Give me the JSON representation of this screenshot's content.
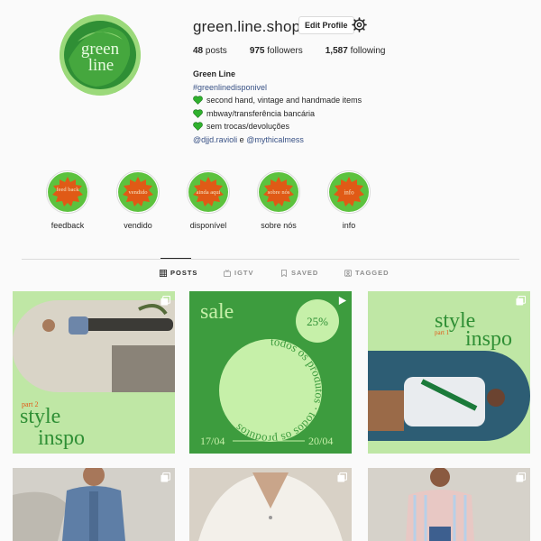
{
  "profile": {
    "username": "green.line.shop",
    "edit_label": "Edit Profile",
    "logo_text_top": "green",
    "logo_text_bottom": "line",
    "stats": {
      "posts": "48",
      "posts_label": "posts",
      "followers": "975",
      "followers_label": "followers",
      "following": "1,587",
      "following_label": "following"
    },
    "bio": {
      "name": "Green Line",
      "hashtag": "#greenlinedisponivel",
      "lines": [
        "second hand, vintage and handmade items",
        "mbway/transferência bancária",
        "sem trocas/devoluções"
      ],
      "mention1": "@djjd.ravioli",
      "connector": "e",
      "mention2": "@mythicalmess"
    }
  },
  "highlights": [
    {
      "label": "feedback",
      "badge": "feed back"
    },
    {
      "label": "vendido",
      "badge": "vendido"
    },
    {
      "label": "disponível",
      "badge": "ainda aqui"
    },
    {
      "label": "sobre nós",
      "badge": "sobre nós"
    },
    {
      "label": "info",
      "badge": "info"
    }
  ],
  "tabs": [
    {
      "label": "POSTS",
      "active": true,
      "icon": "grid-icon"
    },
    {
      "label": "IGTV",
      "active": false,
      "icon": "igtv-icon"
    },
    {
      "label": "SAVED",
      "active": false,
      "icon": "bookmark-icon"
    },
    {
      "label": "TAGGED",
      "active": false,
      "icon": "tag-icon"
    }
  ],
  "posts": {
    "p1": {
      "title_line1": "style",
      "title_line2": "inspo",
      "part": "part 2"
    },
    "p2": {
      "title": "sale",
      "percent": "25%",
      "circle_text": "todos os produtos · todos os produtos",
      "date_start": "17/04",
      "date_end": "20/04"
    },
    "p3": {
      "title_line1": "style",
      "title_line2": "inspo",
      "part": "part 1"
    }
  },
  "colors": {
    "accent_green": "#3e9a3b",
    "light_green": "#b9e4a0",
    "orange": "#e25a17",
    "link_blue": "#385185"
  }
}
